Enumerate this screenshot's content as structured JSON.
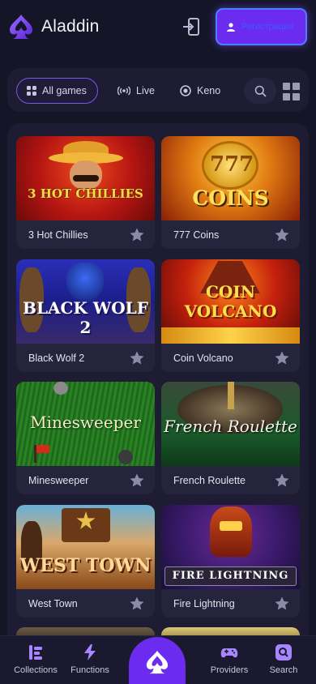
{
  "header": {
    "brand": "Aladdin",
    "signup_label": "Регистрация",
    "colors": {
      "accent": "#6b2cf0",
      "bg": "#151528"
    }
  },
  "filters": {
    "all_games": "All games",
    "live": "Live",
    "keno": "Keno"
  },
  "games": [
    {
      "name": "3 Hot Chillies",
      "art": "3 HOT CHILLIES"
    },
    {
      "name": "777 Coins",
      "art": "COINS"
    },
    {
      "name": "Black Wolf 2",
      "art": "BLACK WOLF 2"
    },
    {
      "name": "Coin Volcano",
      "art": "COIN VOLCANO"
    },
    {
      "name": "Minesweeper",
      "art": "Minesweeper"
    },
    {
      "name": "French Roulette",
      "art": "French Roulette"
    },
    {
      "name": "West Town",
      "art": "WEST TOWN"
    },
    {
      "name": "Fire Lightning",
      "art": "FIRE LIGHTNING"
    }
  ],
  "bottom_nav": {
    "collections": "Collections",
    "functions": "Functions",
    "providers": "Providers",
    "search": "Search"
  }
}
